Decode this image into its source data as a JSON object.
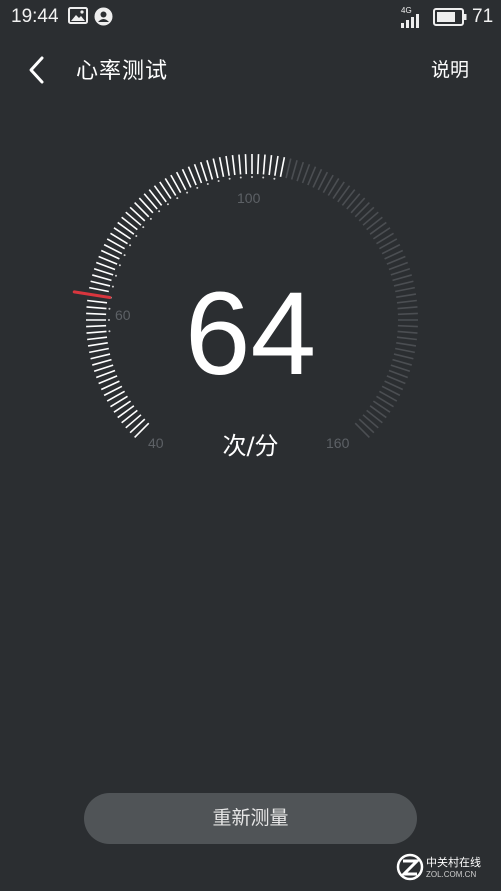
{
  "status_bar": {
    "time": "19:44",
    "network": "4G",
    "battery_percent": "71",
    "icons": [
      "gallery-icon",
      "contact-icon",
      "signal-icon",
      "battery-icon"
    ]
  },
  "app_bar": {
    "title": "心率测试",
    "help_label": "说明",
    "back_icon": "chevron-left-icon"
  },
  "gauge": {
    "value": "64",
    "unit": "次/分",
    "scale_min": 40,
    "scale_max": 160,
    "labels": [
      "40",
      "60",
      "100",
      "160"
    ],
    "filled_until": 105,
    "marker_value": 64,
    "colors": {
      "tick_active": "#ffffff",
      "tick_inactive": "#4b4e52",
      "marker": "#d9363e"
    }
  },
  "actions": {
    "retest_label": "重新测量"
  },
  "watermark": {
    "brand_cn": "中关村在线",
    "brand_en": "ZOL.COM.CN"
  }
}
